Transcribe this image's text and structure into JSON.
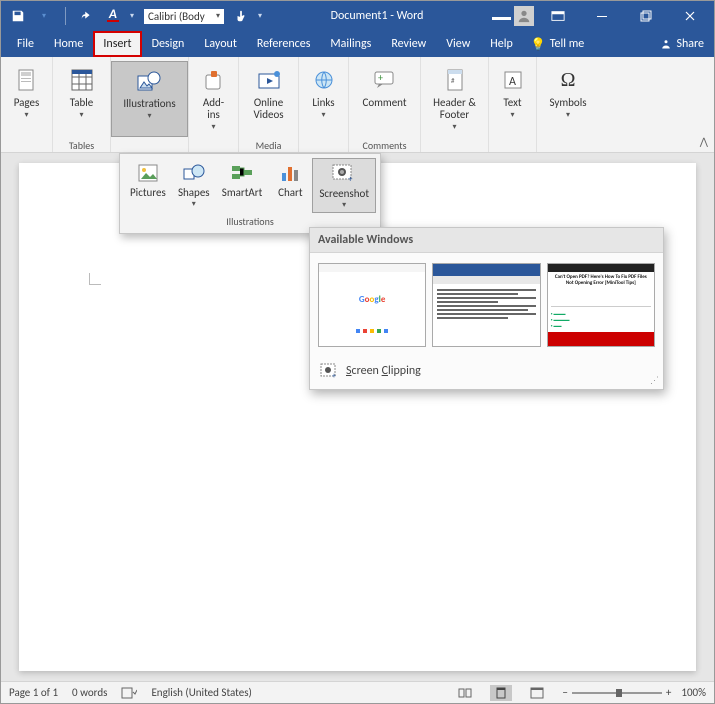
{
  "title": "Document1 - Word",
  "qat": {
    "font": "Calibri (Body"
  },
  "tabs": {
    "file": "File",
    "home": "Home",
    "insert": "Insert",
    "design": "Design",
    "layout": "Layout",
    "references": "References",
    "mailings": "Mailings",
    "review": "Review",
    "view": "View",
    "help": "Help",
    "tellme": "Tell me",
    "share": "Share"
  },
  "ribbon": {
    "pages": "Pages",
    "table": "Table",
    "tables_group": "Tables",
    "illustrations": "Illustrations",
    "addins": "Add-\nins",
    "online_videos": "Online\nVideos",
    "media_group": "Media",
    "links": "Links",
    "comment": "Comment",
    "comments_group": "Comments",
    "header_footer": "Header &\nFooter",
    "text": "Text",
    "symbols": "Symbols"
  },
  "illus": {
    "pictures": "Pictures",
    "shapes": "Shapes",
    "smartart": "SmartArt",
    "chart": "Chart",
    "screenshot": "Screenshot",
    "group": "Illustrations"
  },
  "scrmenu": {
    "header": "Available Windows",
    "clipping": "Screen Clipping",
    "thumb3_title": "Can't Open PDF? Here's How To Fix PDF Files Not Opening Error [MiniTool Tips]"
  },
  "status": {
    "page": "Page 1 of 1",
    "words": "0 words",
    "lang": "English (United States)",
    "zoom": "100%"
  }
}
